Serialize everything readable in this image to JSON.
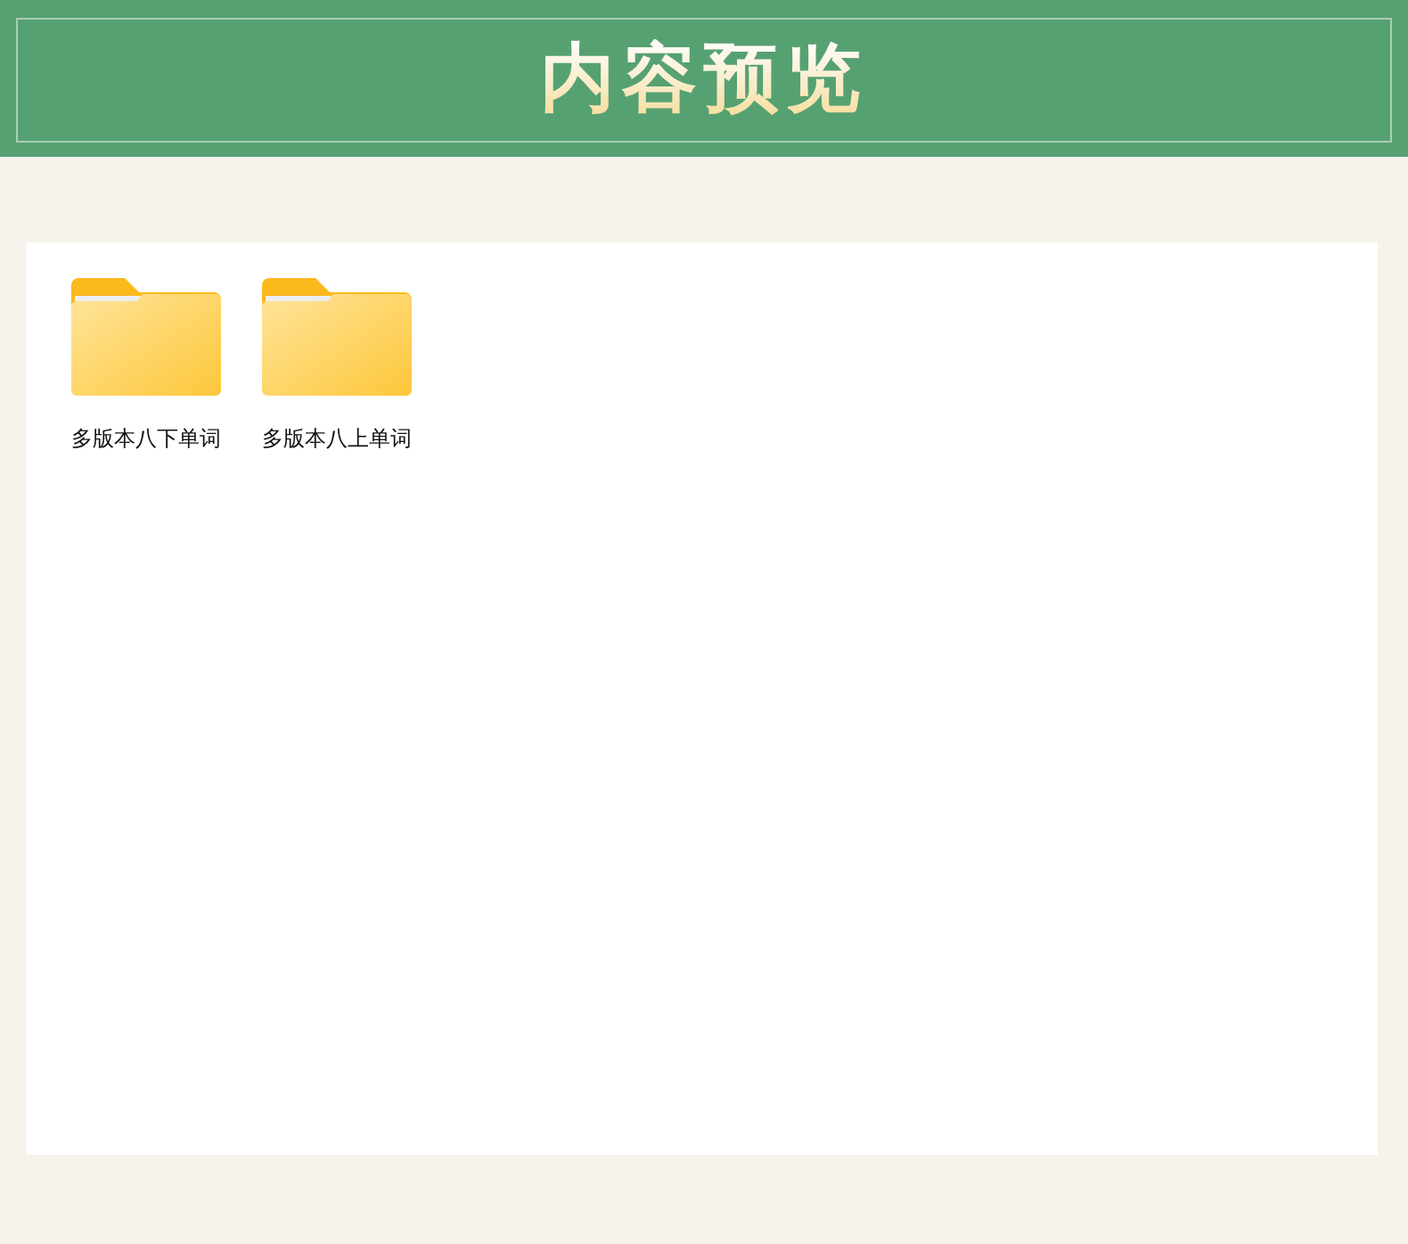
{
  "header": {
    "title": "内容预览"
  },
  "folders": [
    {
      "name": "多版本八下单词"
    },
    {
      "name": "多版本八上单词"
    }
  ]
}
